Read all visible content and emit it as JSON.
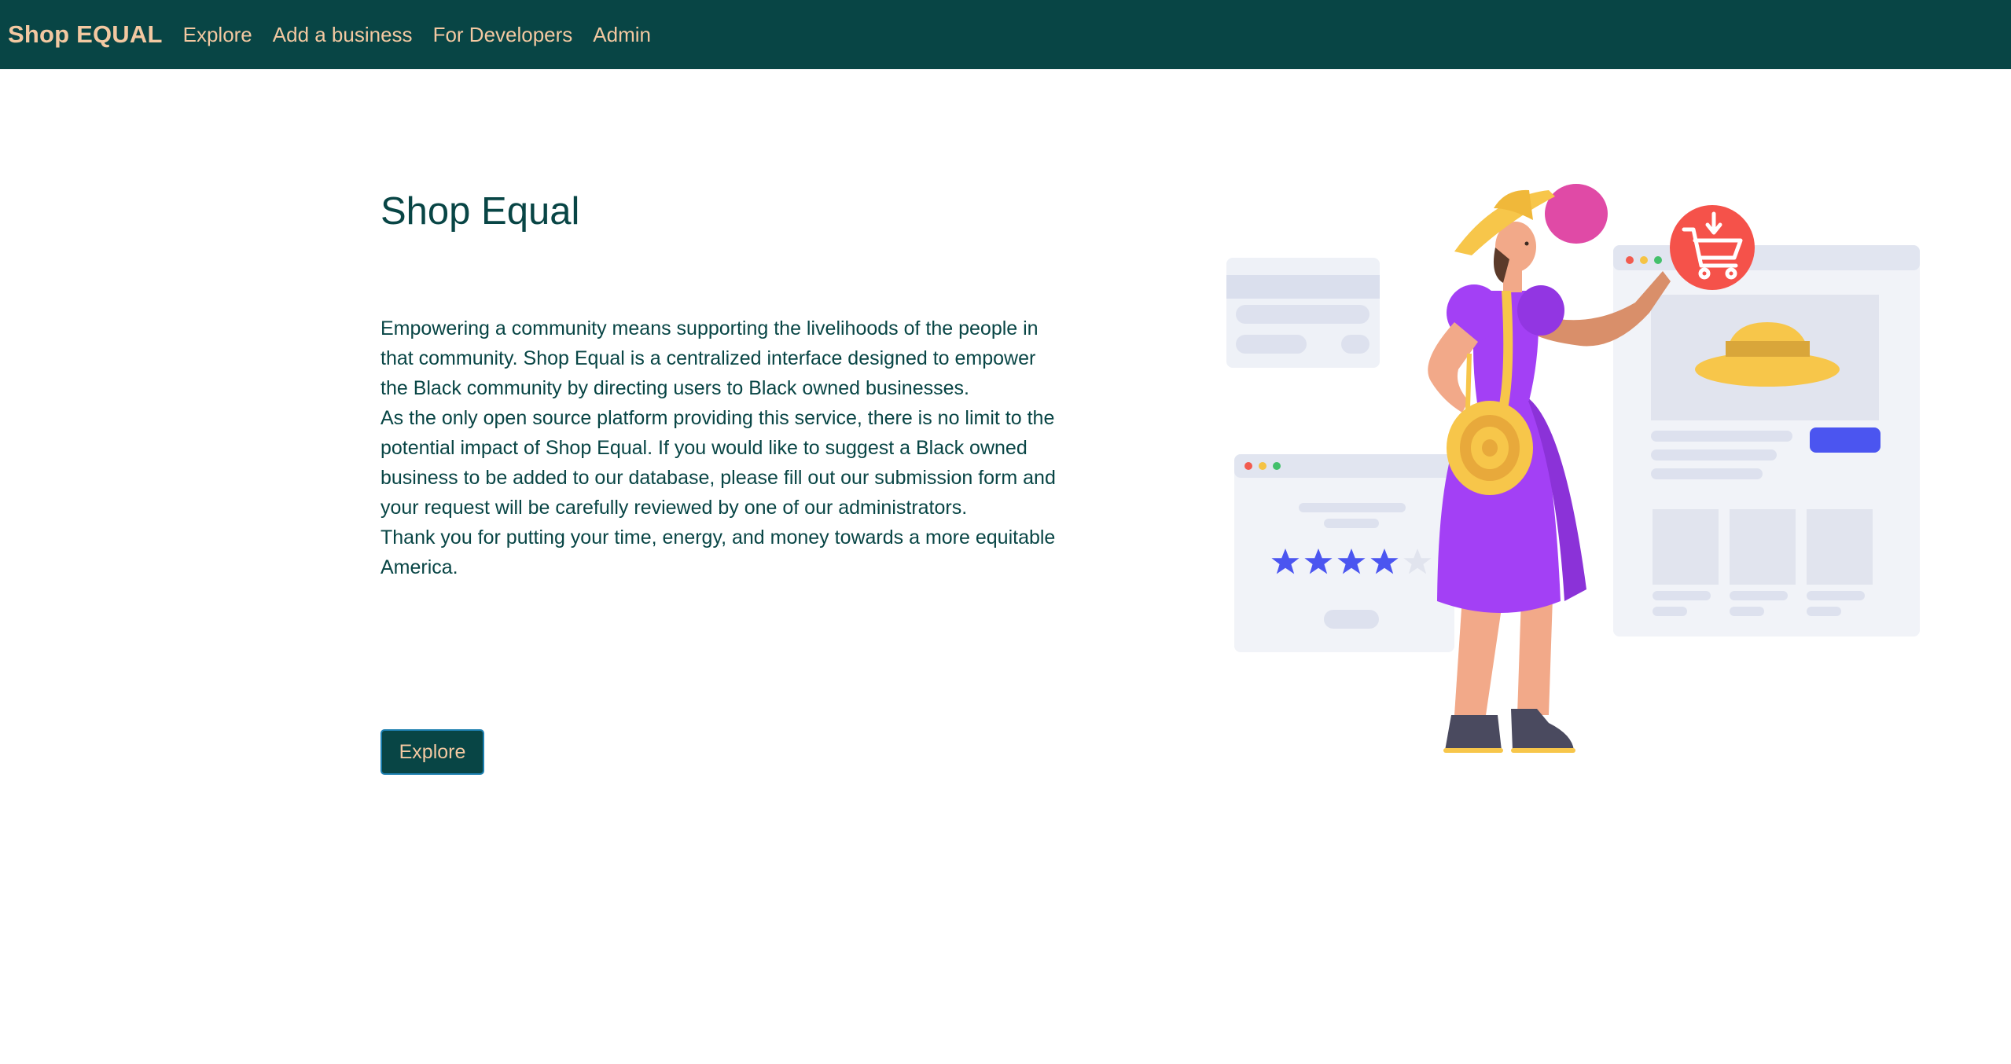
{
  "navbar": {
    "brand": "Shop EQUAL",
    "links": [
      "Explore",
      "Add a business",
      "For Developers",
      "Admin"
    ]
  },
  "hero": {
    "title": "Shop Equal",
    "paragraphs": [
      "Empowering a community means supporting the livelihoods of the people in that community. Shop Equal is a centralized interface designed to empower the Black community by directing users to Black owned businesses.",
      "As the only open source platform providing this service, there is no limit to the potential impact of Shop Equal. If you would like to suggest a Black owned business to be added to our database, please fill out our submission form and your request will be carefully reviewed by one of our administrators.",
      "Thank you for putting your time, energy, and money towards a more equitable America."
    ],
    "explore_button": "Explore"
  },
  "illustration": {
    "rating_stars_filled": 4,
    "rating_stars_total": 5,
    "icons": [
      "shopping-cart-icon",
      "star-icon",
      "hat-icon"
    ]
  },
  "colors": {
    "navbar_bg": "#084545",
    "nav_text": "#f3c8a1",
    "body_text": "#084545",
    "button_border": "#1d7fb0",
    "dress": "#a340f5",
    "cart_badge": "#f5524a",
    "star": "#4b55f0",
    "hat": "#f7c64a"
  }
}
